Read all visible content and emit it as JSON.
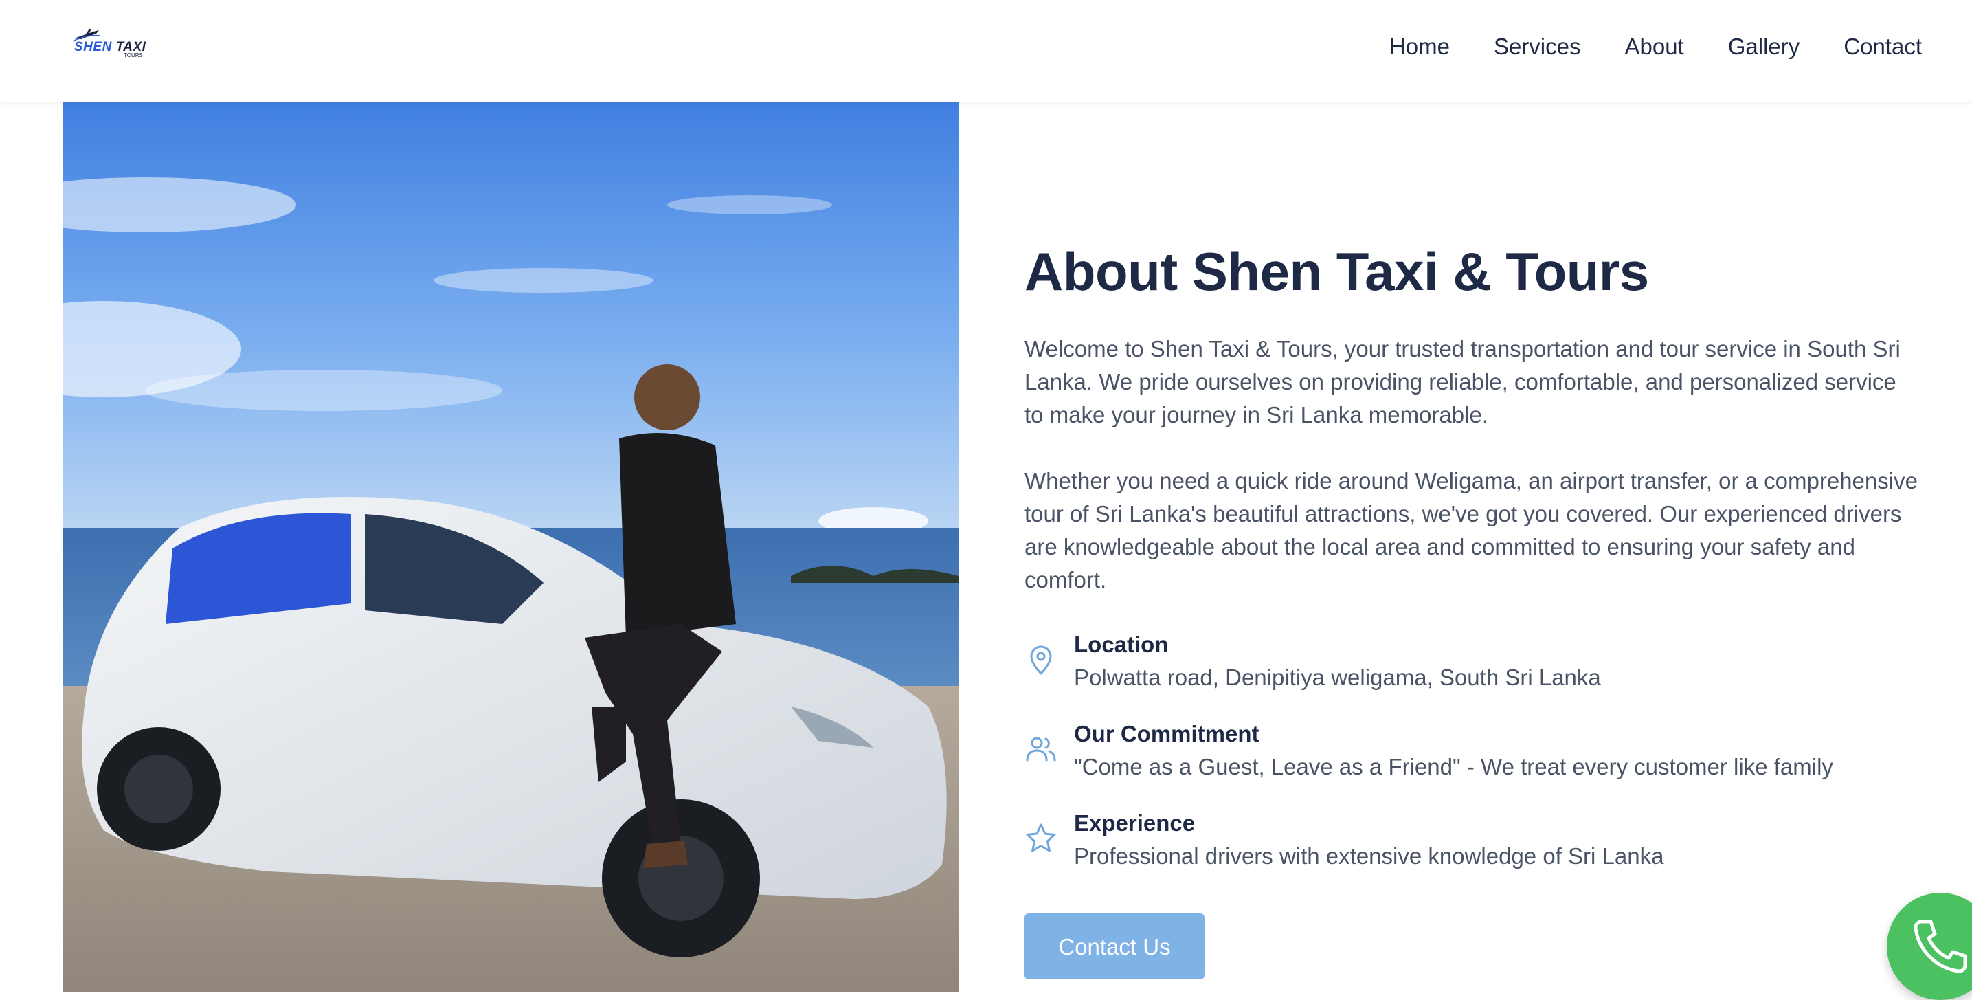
{
  "brand": {
    "logo_text_main": "SHEN",
    "logo_text_taxi": "TAXI",
    "logo_sub": "TOURS"
  },
  "nav": {
    "items": [
      "Home",
      "Services",
      "About",
      "Gallery",
      "Contact"
    ]
  },
  "about": {
    "title": "About Shen Taxi & Tours",
    "paragraph_1": "Welcome to Shen Taxi & Tours, your trusted transportation and tour service in South Sri Lanka. We pride ourselves on providing reliable, comfortable, and personalized service to make your journey in Sri Lanka memorable.",
    "paragraph_2": "Whether you need a quick ride around Weligama, an airport transfer, or a comprehensive tour of Sri Lanka's beautiful attractions, we've got you covered. Our experienced drivers are knowledgeable about the local area and committed to ensuring your safety and comfort."
  },
  "features": [
    {
      "icon": "location-pin-icon",
      "title": "Location",
      "text": "Polwatta road, Denipitiya weligama, South Sri Lanka"
    },
    {
      "icon": "users-icon",
      "title": "Our Commitment",
      "text": "\"Come as a Guest, Leave as a Friend\" - We treat every customer like family"
    },
    {
      "icon": "star-icon",
      "title": "Experience",
      "text": "Professional drivers with extensive knowledge of Sri Lanka"
    }
  ],
  "cta": {
    "label": "Contact Us"
  },
  "colors": {
    "accent": "#7fb2e5",
    "icon_blue": "#6ea6db",
    "phone_green": "#4cc162",
    "heading": "#1e2a45",
    "body_text": "#4a5365"
  },
  "fab": {
    "icon": "phone-icon"
  }
}
